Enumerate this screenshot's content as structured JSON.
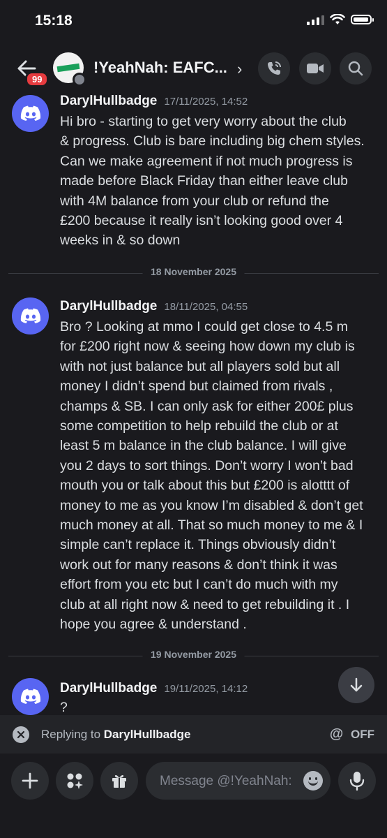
{
  "status_bar": {
    "time": "15:18"
  },
  "header": {
    "unread_badge": "99",
    "title": "!YeahNah: EAFC...",
    "icons": [
      "arrow-left-icon",
      "phone-icon",
      "video-icon",
      "search-icon",
      "chevron-right-icon"
    ]
  },
  "messages": [
    {
      "author": "DarylHullbadge",
      "timestamp": "17/11/2025, 14:52",
      "lines": [
        "Hi bro - starting to get very worry about the club",
        "& progress. Club is bare including big chem styles.",
        "Can we make agreement if not much progress is",
        "made before Black Friday than either leave club",
        "with 4M balance from your club or refund the",
        "£200 because it really isn’t looking good over 4",
        "weeks in & so down"
      ]
    },
    {
      "author": "DarylHullbadge",
      "timestamp": "18/11/2025, 04:55",
      "lines": [
        "Bro ? Looking at mmo I could get close to 4.5 m",
        "for £200 right now & seeing how down my club is",
        "with not just balance but all players sold but all",
        "money I didn’t spend but claimed from rivals ,",
        "champs & SB. I can only ask for either 200£ plus",
        "some competition to help rebuild the club or at",
        "least 5 m balance in the club balance. I will give",
        "you 2 days to sort things. Don’t worry I won’t bad",
        "mouth you or talk about this but £200 is alotttt of",
        "money to me as you know I’m disabled & don’t get",
        "much money at all. That so much money to me & I",
        "simple can’t replace it. Things obviously didn’t",
        "work out for many reasons & don’t think it was",
        "effort from you etc but I can’t do much with my",
        "club at all right now & need to get rebuilding it . I",
        "hope you agree & understand ."
      ]
    },
    {
      "author": "DarylHullbadge",
      "timestamp": "19/11/2025, 14:12",
      "lines": [
        "?"
      ]
    }
  ],
  "dividers": [
    "18 November 2025",
    "19 November 2025"
  ],
  "reply_bar": {
    "prefix": "Replying to ",
    "target": "DarylHullbadge",
    "mention_label": "OFF"
  },
  "composer": {
    "placeholder": "Message @!YeahNah: EAFC Accounts",
    "icons": [
      "plus-icon",
      "apps-icon",
      "gift-icon",
      "emoji-icon",
      "microphone-icon"
    ]
  },
  "colors": {
    "accent": "#5865f2",
    "badge": "#e63b3f",
    "background": "#1a1a1e"
  }
}
